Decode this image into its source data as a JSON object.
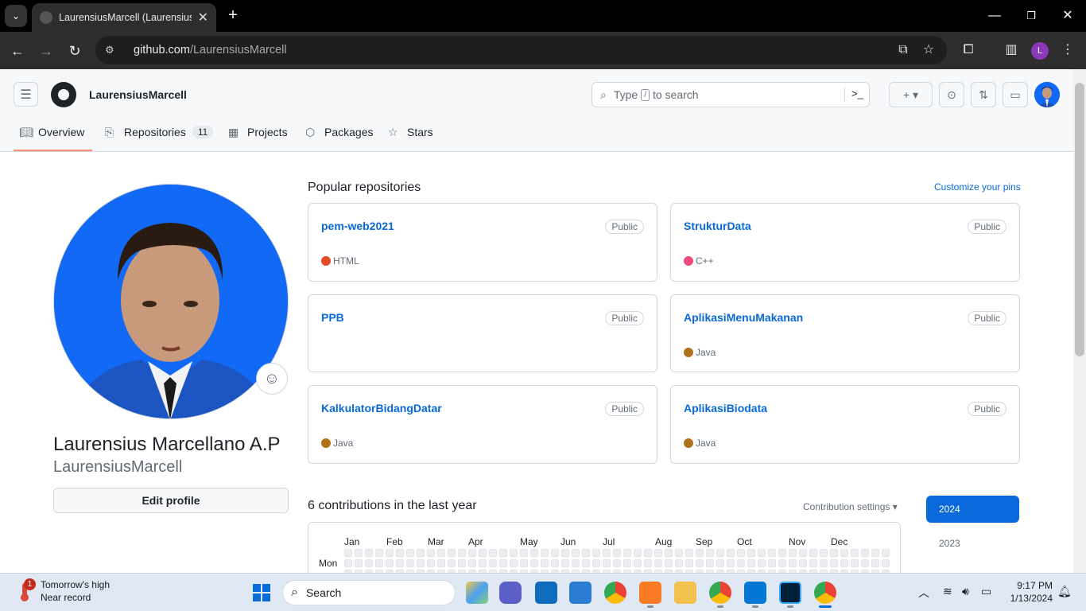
{
  "browser": {
    "tab_title": "LaurensiusMarcell (Laurensius M",
    "url_host": "github.com",
    "url_path": "/LaurensiusMarcell",
    "profile_initial": "L"
  },
  "header": {
    "username": "LaurensiusMarcell",
    "search_prefix": "Type",
    "search_key": "/",
    "search_suffix": "to search",
    "create_label": "+ ▾"
  },
  "nav": {
    "tabs": [
      {
        "label": "Overview",
        "icon": "book-icon"
      },
      {
        "label": "Repositories",
        "count": "11",
        "icon": "repo-icon"
      },
      {
        "label": "Projects",
        "icon": "table-icon"
      },
      {
        "label": "Packages",
        "icon": "package-icon"
      },
      {
        "label": "Stars",
        "icon": "star-icon"
      }
    ],
    "active": "Overview"
  },
  "profile": {
    "full_name": "Laurensius Marcellano A.P",
    "login": "LaurensiusMarcell",
    "edit_label": "Edit profile"
  },
  "popular": {
    "title": "Popular repositories",
    "customize": "Customize your pins",
    "repos": [
      {
        "name": "pem-web2021",
        "visibility": "Public",
        "language": "HTML",
        "color": "#e34c26"
      },
      {
        "name": "StrukturData",
        "visibility": "Public",
        "language": "C++",
        "color": "#f34b7d"
      },
      {
        "name": "PPB",
        "visibility": "Public",
        "language": "",
        "color": ""
      },
      {
        "name": "AplikasiMenuMakanan",
        "visibility": "Public",
        "language": "Java",
        "color": "#b07219"
      },
      {
        "name": "KalkulatorBidangDatar",
        "visibility": "Public",
        "language": "Java",
        "color": "#b07219"
      },
      {
        "name": "AplikasiBiodata",
        "visibility": "Public",
        "language": "Java",
        "color": "#b07219"
      }
    ]
  },
  "contributions": {
    "title": "6 contributions in the last year",
    "settings": "Contribution settings ▾",
    "months": [
      "Jan",
      "Feb",
      "Mar",
      "Apr",
      "May",
      "Jun",
      "Jul",
      "Aug",
      "Sep",
      "Oct",
      "Nov",
      "Dec"
    ],
    "day_label": "Mon",
    "years": [
      "2024",
      "2023"
    ],
    "selected_year": "2024"
  },
  "taskbar": {
    "weather_line1": "Tomorrow's high",
    "weather_line2": "Near record",
    "weather_badge": "1",
    "search_label": "Search",
    "time": "9:17 PM",
    "date": "1/13/2024"
  }
}
